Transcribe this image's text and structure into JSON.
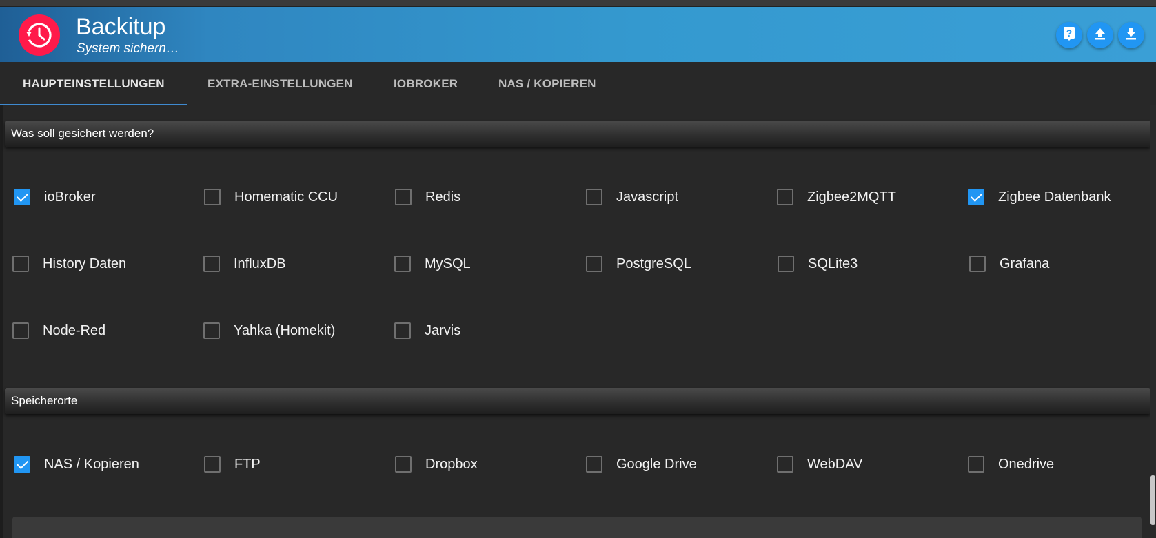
{
  "app": {
    "title": "Backitup",
    "subtitle": "System sichern…"
  },
  "header_buttons": [
    {
      "name": "help-button",
      "icon": "help-icon"
    },
    {
      "name": "upload-button",
      "icon": "upload-icon"
    },
    {
      "name": "download-button",
      "icon": "download-icon"
    }
  ],
  "tabs": [
    {
      "label": "HAUPTEINSTELLUNGEN",
      "active": true
    },
    {
      "label": "EXTRA-EINSTELLUNGEN",
      "active": false
    },
    {
      "label": "IOBROKER",
      "active": false
    },
    {
      "label": "NAS / KOPIEREN",
      "active": false
    }
  ],
  "sections": {
    "backup": {
      "title": "Was soll gesichert werden?",
      "items": [
        {
          "label": "ioBroker",
          "checked": true
        },
        {
          "label": "Homematic CCU",
          "checked": false
        },
        {
          "label": "Redis",
          "checked": false
        },
        {
          "label": "Javascript",
          "checked": false
        },
        {
          "label": "Zigbee2MQTT",
          "checked": false
        },
        {
          "label": "Zigbee Datenbank",
          "checked": true
        },
        {
          "label": "History Daten",
          "checked": false
        },
        {
          "label": "InfluxDB",
          "checked": false
        },
        {
          "label": "MySQL",
          "checked": false
        },
        {
          "label": "PostgreSQL",
          "checked": false
        },
        {
          "label": "SQLite3",
          "checked": false
        },
        {
          "label": "Grafana",
          "checked": false
        },
        {
          "label": "Node-Red",
          "checked": false
        },
        {
          "label": "Yahka (Homekit)",
          "checked": false
        },
        {
          "label": "Jarvis",
          "checked": false
        }
      ]
    },
    "storage": {
      "title": "Speicherorte",
      "items": [
        {
          "label": "NAS / Kopieren",
          "checked": true
        },
        {
          "label": "FTP",
          "checked": false
        },
        {
          "label": "Dropbox",
          "checked": false
        },
        {
          "label": "Google Drive",
          "checked": false
        },
        {
          "label": "WebDAV",
          "checked": false
        },
        {
          "label": "Onedrive",
          "checked": false
        }
      ]
    }
  },
  "colors": {
    "accent": "#2196f3",
    "header": "#3499cf",
    "logo": "#ff1a4a",
    "background": "#282828"
  }
}
